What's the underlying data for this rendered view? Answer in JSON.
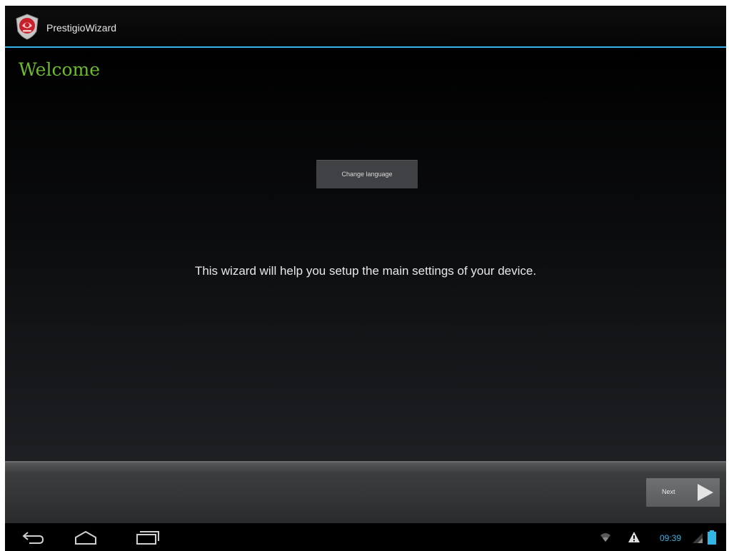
{
  "app": {
    "title": "PrestigioWizard"
  },
  "content": {
    "heading": "Welcome",
    "change_language_label": "Change language",
    "message": "This wizard will help you setup the main settings of your device."
  },
  "footer": {
    "next_label": "Next"
  },
  "system_bar": {
    "time": "09:39",
    "icons": [
      "back-icon",
      "home-icon",
      "recent-apps-icon",
      "wifi-icon",
      "warning-icon",
      "signal-icon",
      "battery-icon"
    ]
  },
  "colors": {
    "accent": "#33b5e5",
    "heading": "#6dbb2c",
    "background": "#000000"
  }
}
